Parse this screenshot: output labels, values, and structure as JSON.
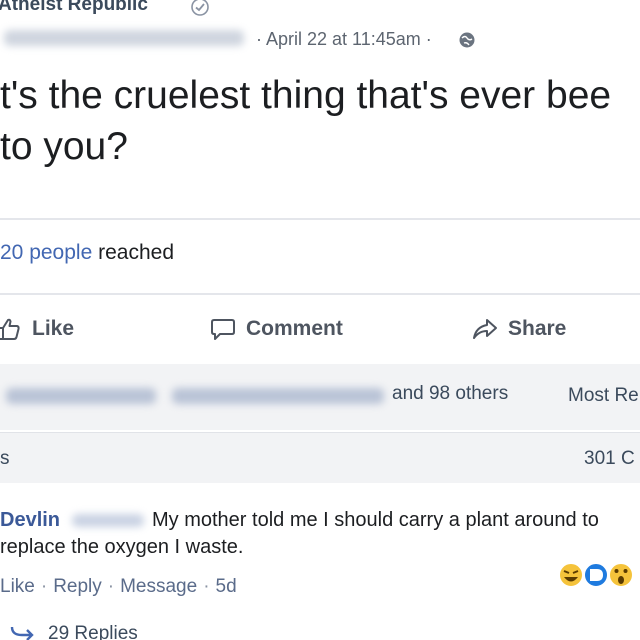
{
  "post": {
    "page_name": "Atheist Republic",
    "date_meta": "· April 22 at 11:45am ·",
    "text_line1": "t's the cruelest thing that's ever bee",
    "text_line2": "to you?"
  },
  "stats": {
    "reach_count": "20 people",
    "reach_label": "reached"
  },
  "actions": {
    "like": "Like",
    "comment": "Comment",
    "share": "Share"
  },
  "social": {
    "others": "and 98 others",
    "sort": "Most Re",
    "left_label": "s",
    "comment_count": "301 C"
  },
  "comment": {
    "author": "Devlin",
    "text_line1": "My mother told me I should carry a plant around to",
    "text_line2": "replace the oxygen I waste.",
    "like": "Like",
    "reply": "Reply",
    "message": "Message",
    "time": "5d",
    "replies": "29 Replies",
    "separator": "·"
  },
  "icons": [
    "verified-icon",
    "globe-icon",
    "like-icon",
    "comment-icon",
    "share-icon",
    "reaction-icons",
    "reply-arrow-icon"
  ],
  "colors": {
    "link_blue": "#4267b2",
    "author_blue": "#3b5998",
    "action_gray": "#4e5560",
    "muted": "#5d6570",
    "reaction_yellow": "#f5c33b",
    "reaction_blue": "#1f7bdf"
  }
}
